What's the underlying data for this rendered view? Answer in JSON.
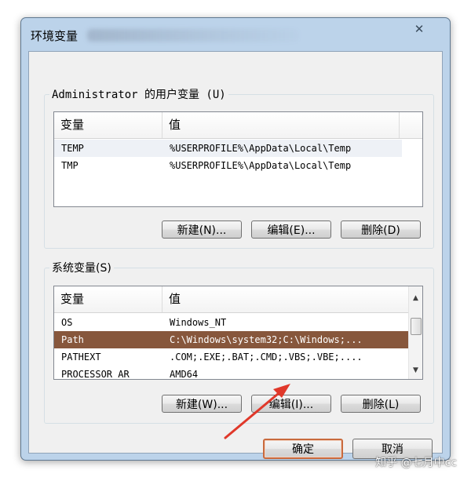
{
  "window": {
    "title": "环境变量",
    "close_glyph": "✕"
  },
  "user_vars": {
    "legend": "Administrator 的用户变量 (U)",
    "columns": [
      "变量",
      "值"
    ],
    "rows": [
      {
        "name": "TEMP",
        "value": "%USERPROFILE%\\AppData\\Local\\Temp"
      },
      {
        "name": "TMP",
        "value": "%USERPROFILE%\\AppData\\Local\\Temp"
      }
    ],
    "buttons": {
      "new": "新建(N)...",
      "edit": "编辑(E)...",
      "delete": "删除(D)"
    }
  },
  "system_vars": {
    "legend": "系统变量(S)",
    "columns": [
      "变量",
      "值"
    ],
    "rows": [
      {
        "name": "OS",
        "value": "Windows_NT"
      },
      {
        "name": "Path",
        "value": "C:\\Windows\\system32;C:\\Windows;..."
      },
      {
        "name": "PATHEXT",
        "value": ".COM;.EXE;.BAT;.CMD;.VBS;.VBE;...."
      },
      {
        "name": "PROCESSOR_AR",
        "value": "AMD64"
      }
    ],
    "selected_row": 1,
    "buttons": {
      "new": "新建(W)...",
      "edit": "编辑(I)...",
      "delete": "删除(L)"
    }
  },
  "dialog_buttons": {
    "ok": "确定",
    "cancel": "取消"
  },
  "watermark": "知乎 @七月中cc",
  "colors": {
    "selection": "#87573c",
    "arrow": "#e0382a",
    "default_button_border": "#c96a3d"
  }
}
